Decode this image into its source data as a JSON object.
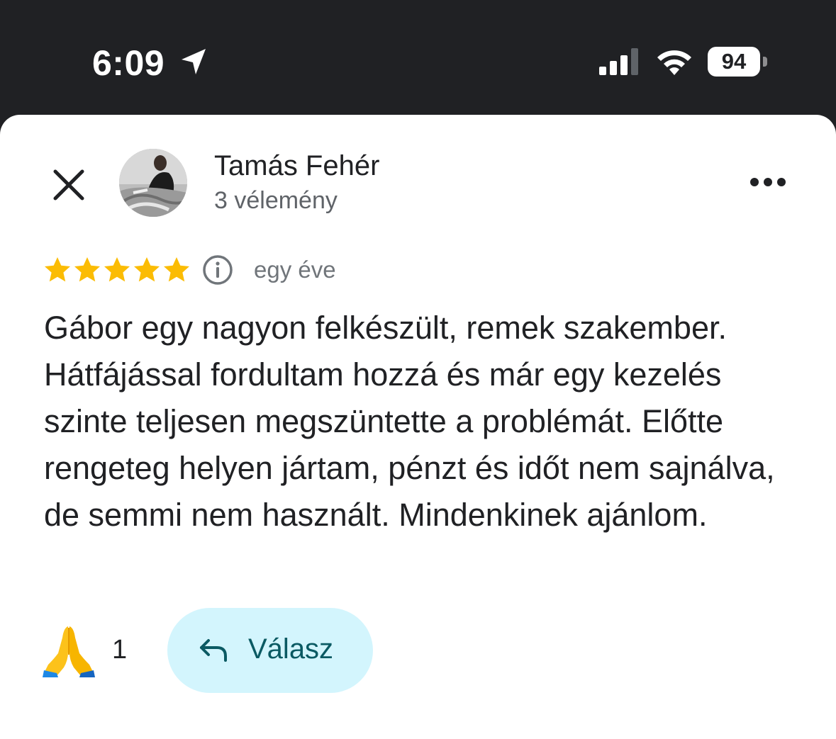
{
  "status_bar": {
    "time": "6:09",
    "battery": "94",
    "icons": [
      "location-arrow-icon",
      "signal-icon",
      "wifi-icon",
      "battery-icon"
    ]
  },
  "review": {
    "author_name": "Tamás Fehér",
    "review_count": "3 vélemény",
    "rating": 5,
    "rating_max": 5,
    "date": "egy éve",
    "text": "Gábor egy nagyon felkészült, remek szakember. Hátfájással fordultam hozzá és már egy kezelés szinte teljesen megszüntette a problémát. Előtte rengeteg helyen jártam, pénzt és időt nem sajnálva, de semmi nem használt. Mindenkinek ajánlom.",
    "reaction_emoji": "🙏",
    "reaction_count": "1",
    "reply_label": "Válasz"
  },
  "colors": {
    "star": "#fbbc04",
    "reply_bg": "#d3f5fd",
    "reply_fg": "#0b5a63",
    "status_bg": "#202124"
  }
}
